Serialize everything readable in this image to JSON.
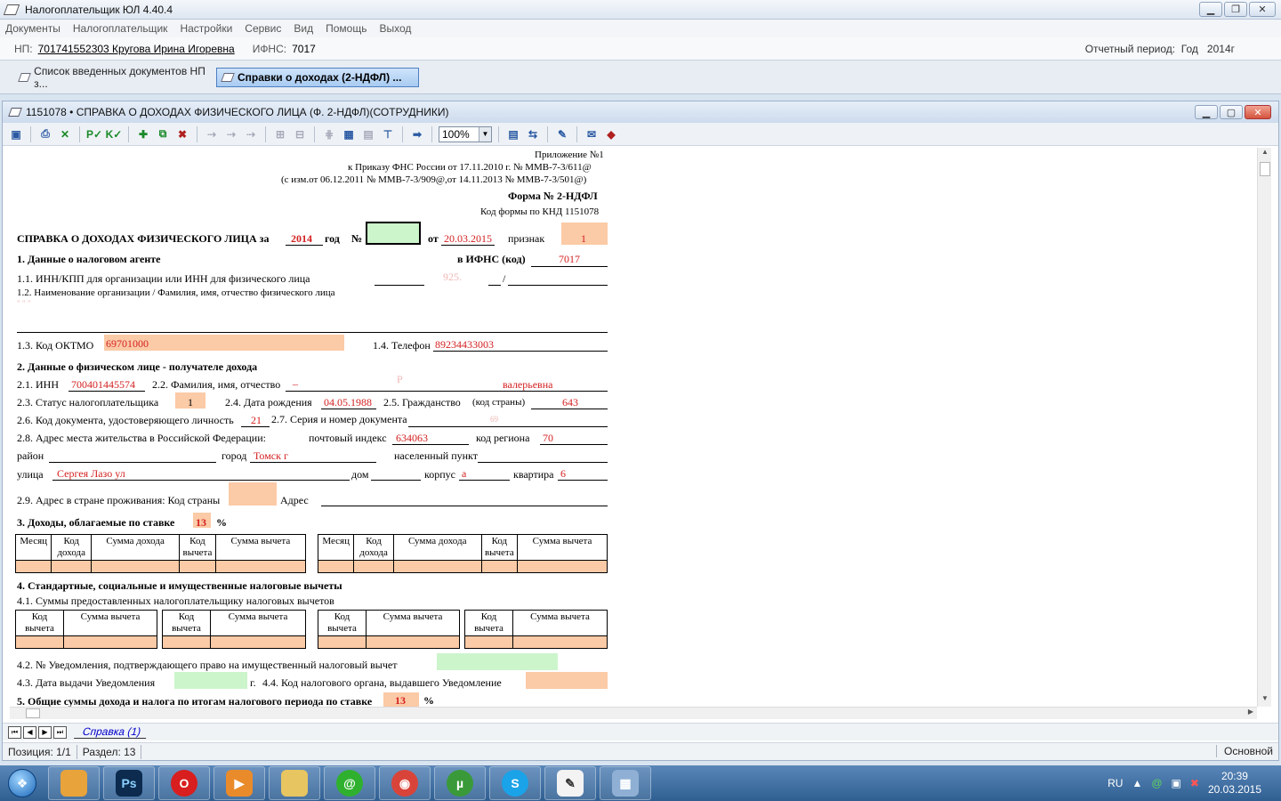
{
  "window": {
    "title": "Налогоплательщик ЮЛ 4.40.4"
  },
  "menu": [
    "Документы",
    "Налогоплательщик",
    "Настройки",
    "Сервис",
    "Вид",
    "Помощь",
    "Выход"
  ],
  "np_bar": {
    "np_label": "НП:",
    "np_value": "701741552303 Кругова Ирина Игоревна",
    "ifns_label": "ИФНС:",
    "ifns_value": "7017",
    "period_label": "Отчетный период:",
    "period_type": "Год",
    "period_value": "2014г"
  },
  "doc_tabs": [
    {
      "label": "Список введенных документов НП з..."
    },
    {
      "label": "Справки о доходах (2-НДФЛ) ..."
    }
  ],
  "child": {
    "title": "1151078 • СПРАВКА О ДОХОДАХ ФИЗИЧЕСКОГО ЛИЦА (Ф. 2-НДФЛ)(СОТРУДНИКИ)"
  },
  "toolbar": {
    "zoom": "100%",
    "icons": [
      "save-icon",
      "print-icon",
      "excel-icon",
      "check-p-icon",
      "check-k-icon",
      "add-icon",
      "copy-icon",
      "delete-icon",
      "d1-icon",
      "d2-icon",
      "d3-icon",
      "d4-icon",
      "d5-icon",
      "d6-icon",
      "calc-icon",
      "calendar-icon",
      "format-icon",
      "arrow-right-icon",
      "page-icon",
      "export-icon",
      "tools-icon",
      "note-icon",
      "book-icon"
    ],
    "glyphs": {
      "save": "▣",
      "print": "⎙",
      "excel": "✕",
      "check_p": "P✓",
      "check_k": "K✓",
      "add": "✚",
      "copy": "⧉",
      "delete": "✖",
      "d1": "⇢",
      "d2": "⇢",
      "d3": "⇢",
      "d4": "⊞",
      "d5": "⊟",
      "d6": "⋕",
      "calc": "▦",
      "calendar": "▤",
      "format": "⊤",
      "arrow": "➡",
      "page": "▤",
      "export": "⇆",
      "tools": "✎",
      "note": "✉",
      "book": "◆"
    }
  },
  "form": {
    "appendix": "Приложение №1",
    "order": "к Приказу ФНС России от 17.11.2010 г. № ММВ-7-3/611@",
    "changes": "(с изм.от 06.12.2011 № ММВ-7-3/909@,от 14.11.2013 № ММВ-7-3/501@)",
    "form_name": "Форма № 2-НДФЛ",
    "knd": "Код формы по КНД 1151078",
    "header": {
      "title": "СПРАВКА О ДОХОДАХ ФИЗИЧЕСКОГО ЛИЦА за",
      "year": "2014",
      "year_label": "год",
      "no_label": "№",
      "from_label": "от",
      "date": "20.03.2015",
      "sign_label": "признак",
      "sign": "1"
    },
    "s1": {
      "title": "1. Данные о налоговом агенте",
      "ifns_label": "в ИФНС (код)",
      "ifns": "7017",
      "l11": "1.1. ИНН/КПП   для организации или ИНН для физического лица",
      "l11_partial": "925.",
      "l11_slash": "/",
      "l12": "1.2. Наименование организации / Фамилия, имя, отчество физического лица",
      "l12_partial": "\" \" \"",
      "l13": "1.3. Код ОКТМО",
      "oktmo": "69701000",
      "l14": "1.4. Телефон",
      "phone": "89234433003"
    },
    "s2": {
      "title": "2. Данные о физическом лице - получателе дохода",
      "l21": "2.1. ИНН",
      "inn": "700401445574",
      "l22": "2.2. Фамилия, имя, отчество",
      "fio_a": "_",
      "fio_b": "Р",
      "fio_c": "валерьевна",
      "l23": "2.3. Статус налогоплательщика",
      "status": "1",
      "l24": "2.4. Дата рождения",
      "birth": "04.05.1988",
      "l25": "2.5. Гражданство",
      "country_label": "(код страны)",
      "country": "643",
      "l26": "2.6. Код документа, удостоверяющего личность",
      "doc": "21",
      "l27": "2.7. Серия и номер документа",
      "series": "69",
      "l28": "2.8. Адрес места жительства в Российской Федерации:",
      "zip_label": "почтовый индекс",
      "zip": "634063",
      "region_label": "код региона",
      "region": "70",
      "district_label": "район",
      "city_label": "город",
      "city": "Томск г",
      "settlement_label": "населенный пункт",
      "street_label": "улица",
      "street": "Сергея Лазо ул",
      "house_label": "дом",
      "corp_label": "корпус",
      "corp": "а",
      "flat_label": "квартира",
      "flat": "6",
      "l29": "2.9. Адрес в стране проживания: Код страны",
      "addr_label": "Адрес"
    },
    "s3": {
      "title": "3. Доходы, облагаемые по ставке",
      "rate": "13",
      "pct": "%",
      "cols": [
        "Месяц",
        "Код дохода",
        "Сумма дохода",
        "Код вычета",
        "Сумма вычета"
      ]
    },
    "s4": {
      "title": "4. Стандартные, социальные и имущественные налоговые вычеты",
      "l41": "4.1. Суммы предоставленных налогоплательщику налоговых вычетов",
      "cols": [
        "Код вычета",
        "Сумма вычета"
      ],
      "l42": "4.2. № Уведомления, подтверждающего право на имущественный налоговый вычет",
      "l43": "4.3. Дата выдачи Уведомления",
      "year_g": "г.",
      "l44": "4.4. Код налогового органа, выдавшего Уведомление"
    },
    "s5": {
      "title": "5. Общие суммы дохода и налога по итогам налогового периода по ставке",
      "rate": "13",
      "pct": "%"
    }
  },
  "sheet_tab": "Справка (1)",
  "status": {
    "position": "Позиция: 1/1",
    "section": "Раздел: 13",
    "mode": "Основной"
  },
  "taskbar": {
    "apps": [
      "start-orb",
      "file-app",
      "photoshop",
      "opera",
      "media-player",
      "folder",
      "icq",
      "chrome",
      "utorrent",
      "skype",
      "taxpayer-app",
      "calculator"
    ],
    "labels": {
      "photoshop": "Ps",
      "opera": "O",
      "icq": "@",
      "chrome": "◉",
      "utorrent": "µ",
      "skype": "S"
    },
    "lang": "RU",
    "time": "20:39",
    "date": "20.03.2015"
  }
}
